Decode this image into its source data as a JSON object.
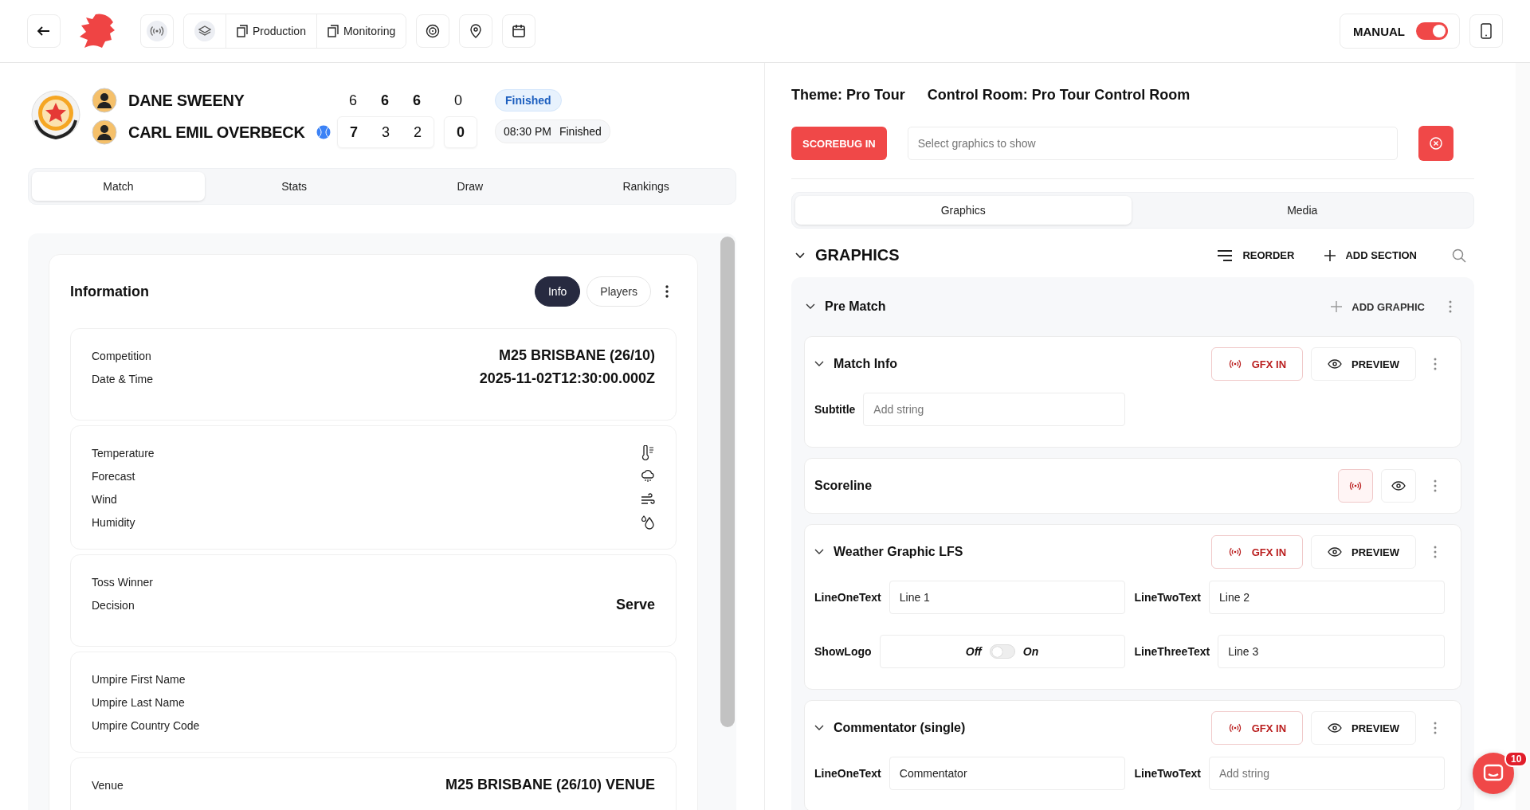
{
  "topbar": {
    "nav_labels": [
      "Production",
      "Monitoring"
    ],
    "mode": {
      "label": "MANUAL",
      "on": true
    }
  },
  "match": {
    "players": [
      {
        "name": "DANE SWEENY",
        "serving": false,
        "sets": [
          {
            "score": "6",
            "won": false
          },
          {
            "score": "6",
            "won": true
          },
          {
            "score": "6",
            "won": true
          }
        ],
        "points": {
          "score": "0",
          "won": false
        }
      },
      {
        "name": "CARL EMIL OVERBECK",
        "serving": true,
        "sets": [
          {
            "score": "7",
            "won": true
          },
          {
            "score": "3",
            "won": false
          },
          {
            "score": "2",
            "won": false
          }
        ],
        "points": {
          "score": "0",
          "won": true
        }
      }
    ],
    "status": "Finished",
    "time": "08:30 PM",
    "time_status": "Finished"
  },
  "tabs": [
    {
      "label": "Match",
      "selected": true
    },
    {
      "label": "Stats",
      "selected": false
    },
    {
      "label": "Draw",
      "selected": false
    },
    {
      "label": "Rankings",
      "selected": false
    }
  ],
  "information": {
    "title": "Information",
    "toggles": [
      {
        "label": "Info",
        "selected": true
      },
      {
        "label": "Players",
        "selected": false
      }
    ],
    "groups": [
      {
        "rows": [
          {
            "label": "Competition",
            "value": "M25 BRISBANE (26/10)"
          },
          {
            "label": "Date & Time",
            "value": "2025-11-02T12:30:00.000Z"
          }
        ]
      },
      {
        "rows": [
          {
            "label": "Temperature",
            "kind": "thermometer"
          },
          {
            "label": "Forecast",
            "kind": "cloud"
          },
          {
            "label": "Wind",
            "kind": "wind"
          },
          {
            "label": "Humidity",
            "kind": "drops"
          }
        ]
      },
      {
        "rows": [
          {
            "label": "Toss Winner"
          },
          {
            "label": "Decision",
            "value": "Serve"
          }
        ]
      },
      {
        "rows": [
          {
            "label": "Umpire First Name"
          },
          {
            "label": "Umpire Last Name"
          },
          {
            "label": "Umpire Country Code"
          }
        ]
      },
      {
        "rows": [
          {
            "label": "Venue",
            "value": "M25 BRISBANE (26/10) VENUE"
          }
        ]
      }
    ]
  },
  "control": {
    "theme": "Theme: Pro Tour",
    "room": "Control Room: Pro Tour Control Room",
    "scorebug": "SCOREBUG IN",
    "select_placeholder": "Select graphics to show"
  },
  "right_tabs": [
    {
      "label": "Graphics",
      "selected": true
    },
    {
      "label": "Media",
      "selected": false
    }
  ],
  "graphics": {
    "title": "GRAPHICS",
    "reorder": "REORDER",
    "add_section": "ADD SECTION",
    "sections": [
      {
        "title": "Pre Match",
        "add": "ADD GRAPHIC",
        "graphics": [
          {
            "title": "Match Info",
            "compact": false,
            "gfx": "GFX IN",
            "preview": "PREVIEW",
            "fields": [
              {
                "kind": "text",
                "label": "Subtitle",
                "placeholder": "Add string"
              }
            ]
          },
          {
            "title": "Scoreline",
            "compact": true
          },
          {
            "title": "Weather Graphic LFS",
            "compact": false,
            "gfx": "GFX IN",
            "preview": "PREVIEW",
            "fields": [
              {
                "kind": "text",
                "label": "LineOneText",
                "value": "Line 1"
              },
              {
                "kind": "text",
                "label": "LineTwoText",
                "value": "Line 2"
              },
              {
                "kind": "toggle",
                "label": "ShowLogo",
                "off": "Off",
                "on_label": "On",
                "on": false
              },
              {
                "kind": "text",
                "label": "LineThreeText",
                "value": "Line 3"
              }
            ]
          },
          {
            "title": "Commentator (single)",
            "compact": false,
            "gfx": "GFX IN",
            "preview": "PREVIEW",
            "fields": [
              {
                "kind": "text",
                "label": "LineOneText",
                "value": "Commentator"
              },
              {
                "kind": "text",
                "label": "LineTwoText",
                "placeholder": "Add string"
              }
            ]
          }
        ]
      }
    ]
  },
  "chat": {
    "badge": "10"
  }
}
